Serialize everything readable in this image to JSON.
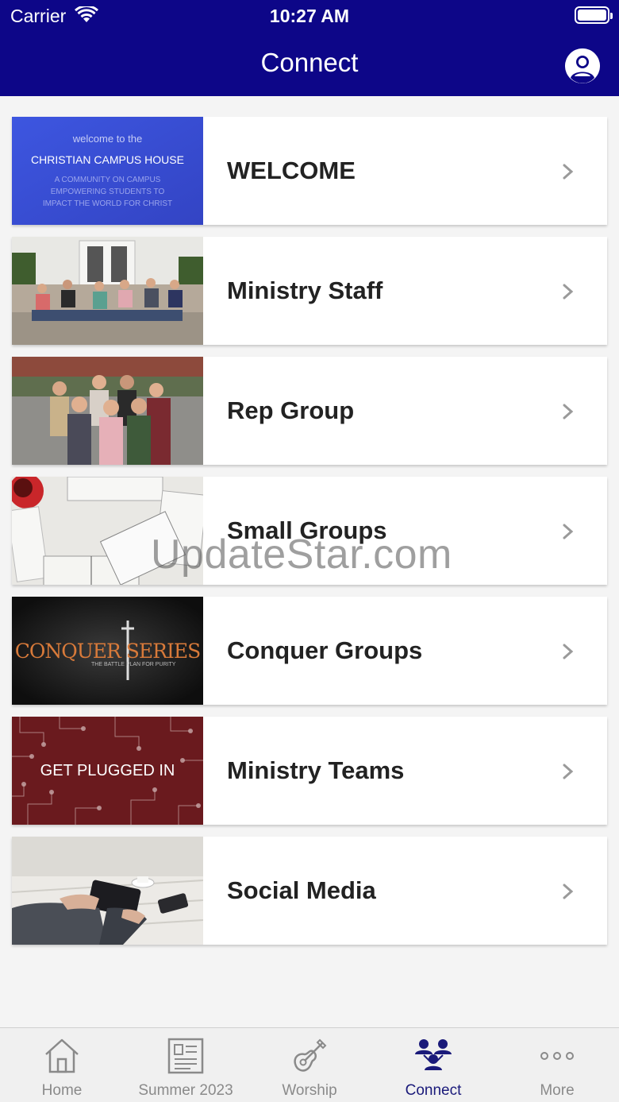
{
  "status_bar": {
    "carrier": "Carrier",
    "time": "10:27 AM"
  },
  "header": {
    "title": "Connect"
  },
  "items": [
    {
      "label": "WELCOME",
      "thumb": {
        "line1": "welcome to the",
        "line2": "CHRISTIAN CAMPUS HOUSE",
        "line3": "A COMMUNITY ON CAMPUS",
        "line4": "EMPOWERING STUDENTS TO",
        "line5": "IMPACT THE WORLD FOR CHRIST"
      }
    },
    {
      "label": "Ministry Staff"
    },
    {
      "label": "Rep Group"
    },
    {
      "label": "Small Groups"
    },
    {
      "label": "Conquer Groups",
      "thumb": {
        "logo": "CONQUER SERIES",
        "tagline": "THE BATTLE PLAN FOR PURITY"
      }
    },
    {
      "label": "Ministry Teams",
      "thumb": {
        "text": "GET PLUGGED IN"
      }
    },
    {
      "label": "Social Media"
    }
  ],
  "watermark": "UpdateStar.com",
  "tabs": [
    {
      "label": "Home",
      "icon": "home-icon"
    },
    {
      "label": "Summer 2023",
      "icon": "document-icon"
    },
    {
      "label": "Worship",
      "icon": "guitar-icon"
    },
    {
      "label": "Connect",
      "icon": "people-icon",
      "active": true
    },
    {
      "label": "More",
      "icon": "more-icon"
    }
  ],
  "colors": {
    "header": "#0d0688",
    "active_tab": "#1a1a7a",
    "inactive_tab": "#8a8a8a"
  }
}
